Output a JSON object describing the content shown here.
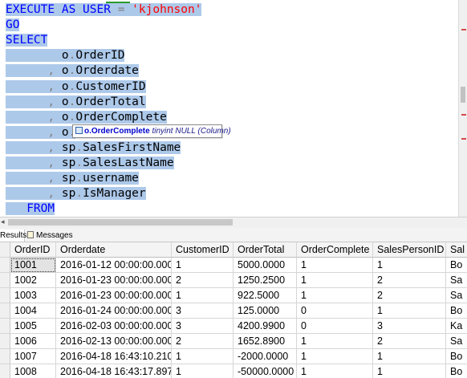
{
  "editor": {
    "lines": [
      {
        "indent": "",
        "tokens": [
          {
            "t": "EXECUTE ",
            "c": "kw"
          },
          {
            "t": "AS ",
            "c": "kw"
          },
          {
            "t": "USER ",
            "c": "kw"
          },
          {
            "t": "= ",
            "c": "gr"
          },
          {
            "t": "'kjohnson'",
            "c": "str"
          }
        ]
      },
      {
        "indent": "",
        "tokens": [
          {
            "t": "GO",
            "c": "kw"
          }
        ]
      },
      {
        "indent": "",
        "tokens": [
          {
            "t": "SELECT",
            "c": "kw"
          }
        ]
      },
      {
        "indent": "        ",
        "tokens": [
          {
            "t": "o",
            "c": "tx"
          },
          {
            "t": ".",
            "c": "gr"
          },
          {
            "t": "OrderID",
            "c": "tx"
          }
        ]
      },
      {
        "indent": "      ",
        "tokens": [
          {
            "t": ", ",
            "c": "gr"
          },
          {
            "t": "o",
            "c": "tx"
          },
          {
            "t": ".",
            "c": "gr"
          },
          {
            "t": "Orderdate",
            "c": "tx"
          }
        ]
      },
      {
        "indent": "      ",
        "tokens": [
          {
            "t": ", ",
            "c": "gr"
          },
          {
            "t": "o",
            "c": "tx"
          },
          {
            "t": ".",
            "c": "gr"
          },
          {
            "t": "CustomerID",
            "c": "tx"
          }
        ]
      },
      {
        "indent": "      ",
        "tokens": [
          {
            "t": ", ",
            "c": "gr"
          },
          {
            "t": "o",
            "c": "tx"
          },
          {
            "t": ".",
            "c": "gr"
          },
          {
            "t": "OrderTotal",
            "c": "tx"
          }
        ]
      },
      {
        "indent": "      ",
        "tokens": [
          {
            "t": ", ",
            "c": "gr"
          },
          {
            "t": "o",
            "c": "tx"
          },
          {
            "t": ".",
            "c": "gr"
          },
          {
            "t": "OrderComplete",
            "c": "tx"
          }
        ]
      },
      {
        "indent": "      ",
        "tokens": [
          {
            "t": ", ",
            "c": "gr"
          },
          {
            "t": "o",
            "c": "tx"
          },
          {
            "t": ".",
            "c": "gr"
          }
        ]
      },
      {
        "indent": "      ",
        "tokens": [
          {
            "t": ", ",
            "c": "gr"
          },
          {
            "t": "sp",
            "c": "tx"
          },
          {
            "t": ".",
            "c": "gr"
          },
          {
            "t": "SalesFirstName",
            "c": "tx"
          }
        ]
      },
      {
        "indent": "      ",
        "tokens": [
          {
            "t": ", ",
            "c": "gr"
          },
          {
            "t": "sp",
            "c": "tx"
          },
          {
            "t": ".",
            "c": "gr"
          },
          {
            "t": "SalesLastName",
            "c": "tx"
          }
        ]
      },
      {
        "indent": "      ",
        "tokens": [
          {
            "t": ", ",
            "c": "gr"
          },
          {
            "t": "sp",
            "c": "tx"
          },
          {
            "t": ".",
            "c": "gr"
          },
          {
            "t": "username",
            "c": "tx"
          }
        ]
      },
      {
        "indent": "      ",
        "tokens": [
          {
            "t": ", ",
            "c": "gr"
          },
          {
            "t": "sp",
            "c": "tx"
          },
          {
            "t": ".",
            "c": "gr"
          },
          {
            "t": "IsManager",
            "c": "tx"
          }
        ]
      },
      {
        "indent": "   ",
        "tokens": [
          {
            "t": "FROM",
            "c": "kw"
          }
        ]
      }
    ],
    "tooltip": {
      "icon": "column-icon",
      "name": "o.OrderComplete",
      "type": " tinyint NULL (Column)"
    }
  },
  "tabs": {
    "results": "Results",
    "messages": "Messages",
    "messages_icon": "messages-icon"
  },
  "grid": {
    "columns": [
      "OrderID",
      "Orderdate",
      "CustomerID",
      "OrderTotal",
      "OrderComplete",
      "SalesPersonID",
      "Sal"
    ],
    "rows": [
      [
        "1001",
        "2016-01-12 00:00:00.000",
        "1",
        "5000.0000",
        "1",
        "1",
        "Bo"
      ],
      [
        "1002",
        "2016-01-23 00:00:00.000",
        "2",
        "1250.2500",
        "1",
        "2",
        "Sa"
      ],
      [
        "1003",
        "2016-01-23 00:00:00.000",
        "1",
        "922.5000",
        "1",
        "2",
        "Sa"
      ],
      [
        "1004",
        "2016-01-24 00:00:00.000",
        "3",
        "125.0000",
        "0",
        "1",
        "Bo"
      ],
      [
        "1005",
        "2016-02-03 00:00:00.000",
        "3",
        "4200.9900",
        "0",
        "3",
        "Ka"
      ],
      [
        "1006",
        "2016-02-13 00:00:00.000",
        "2",
        "1652.8900",
        "1",
        "2",
        "Sa"
      ],
      [
        "1007",
        "2016-04-18 16:43:10.210",
        "1",
        "-2000.0000",
        "1",
        "1",
        "Bo"
      ],
      [
        "1008",
        "2016-04-18 16:43:17.897",
        "1",
        "-50000.0000",
        "1",
        "1",
        "Bo"
      ]
    ]
  },
  "colors": {
    "selection": "#adc9ea",
    "keyword": "#0000ff",
    "string": "#ff0000",
    "operator": "#808080"
  }
}
